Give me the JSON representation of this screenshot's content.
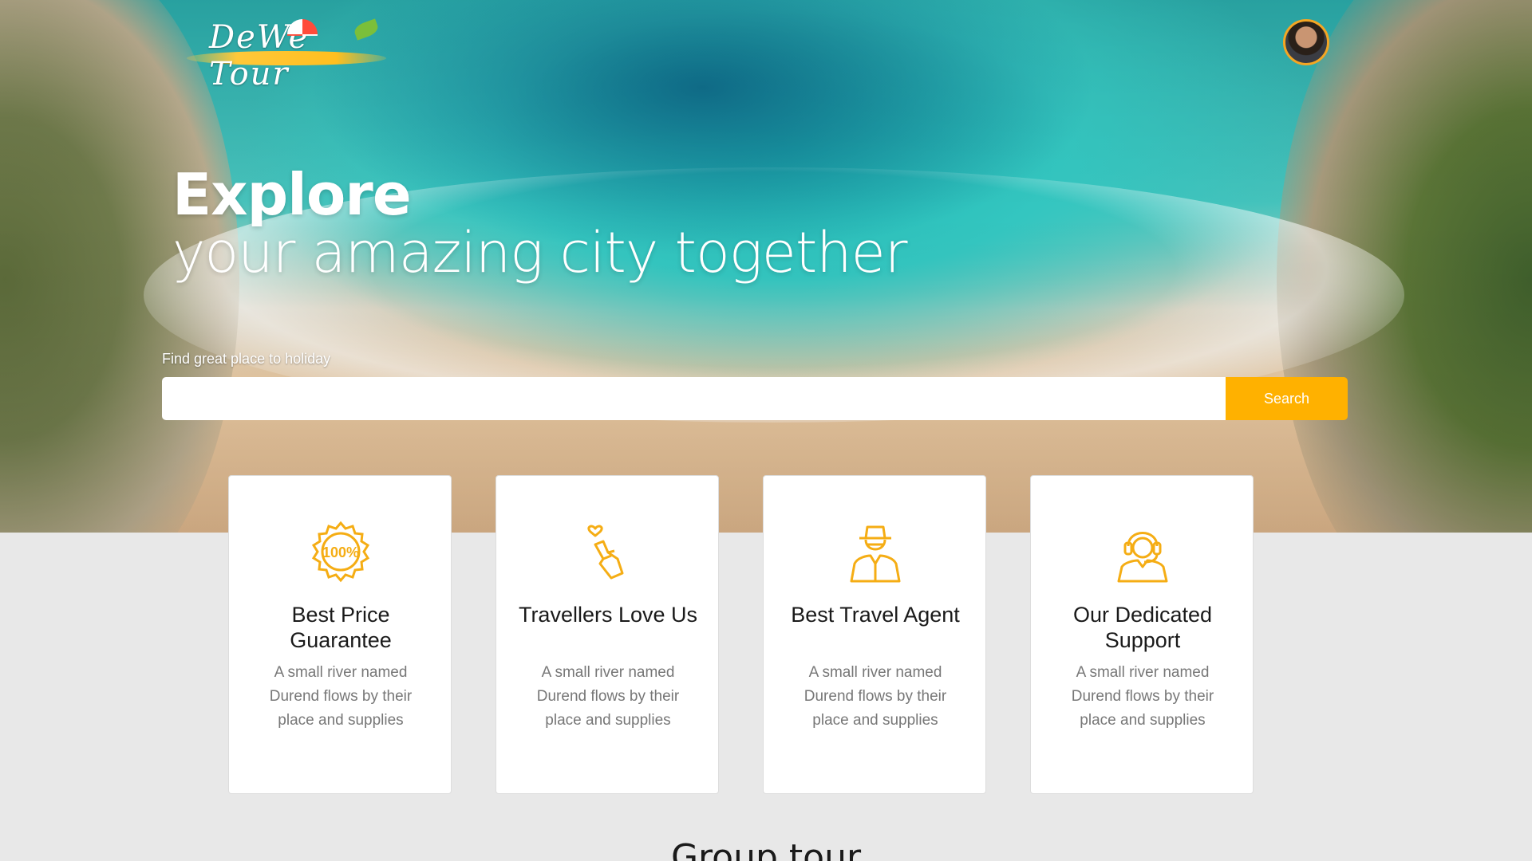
{
  "brand": {
    "logo_text": "DeWe Tour",
    "accent_color": "#ffb100"
  },
  "header": {
    "avatar_icon": "user-avatar"
  },
  "hero": {
    "headline_bold": "Explore",
    "headline_light": "your amazing city together"
  },
  "search": {
    "label": "Find great place to holiday",
    "value": "",
    "placeholder": "",
    "button_label": "Search"
  },
  "features": [
    {
      "icon": "badge-100-percent-icon",
      "title": "Best Price Guarantee",
      "description": "A small river named Durend flows by their place and supplies"
    },
    {
      "icon": "finger-heart-icon",
      "title": "Travellers Love Us",
      "description": "A small river named Durend flows by their place and supplies"
    },
    {
      "icon": "travel-agent-icon",
      "title": "Best Travel Agent",
      "description": "A small river named Durend flows by their place and supplies"
    },
    {
      "icon": "support-agent-icon",
      "title": "Our Dedicated Support",
      "description": "A small river named Durend flows by their place and supplies"
    }
  ],
  "group_tour": {
    "title": "Group tour"
  }
}
